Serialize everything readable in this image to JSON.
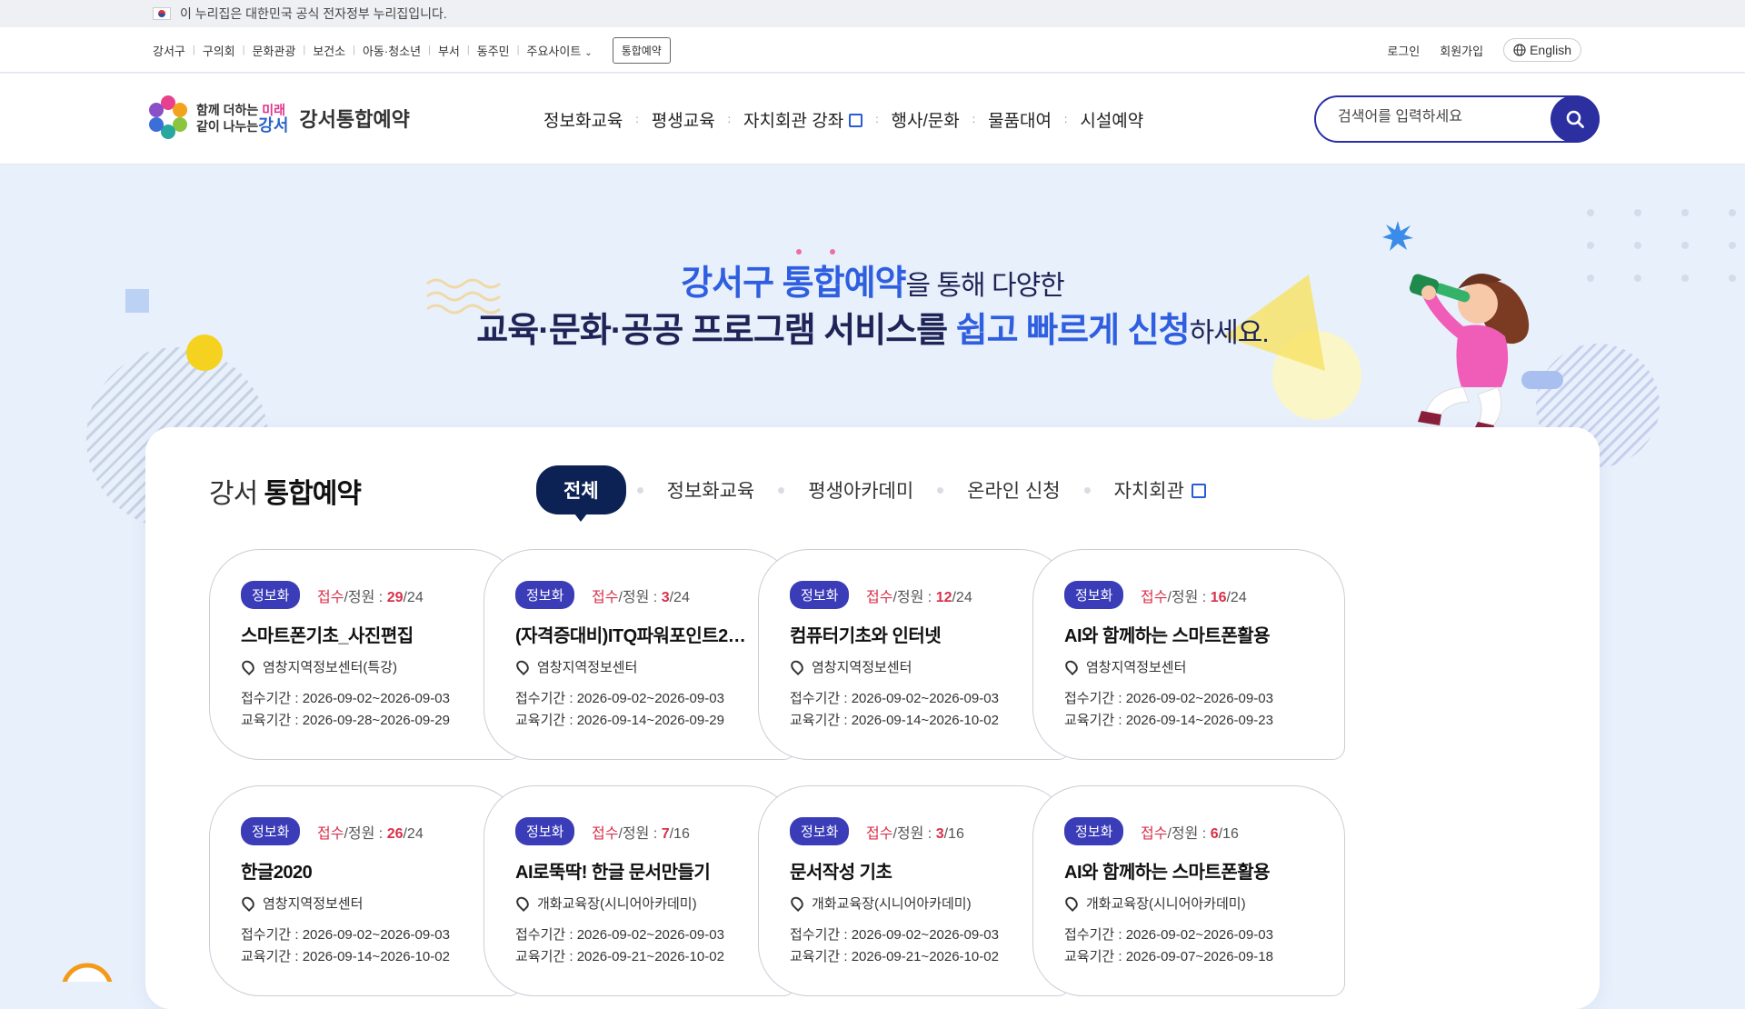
{
  "gov_banner": {
    "text": "이 누리집은 대한민국 공식 전자정부 누리집입니다."
  },
  "util": {
    "links": [
      "강서구",
      "구의회",
      "문화관광",
      "보건소",
      "아동·청소년",
      "부서",
      "동주민",
      "주요사이트"
    ],
    "reserve_button": "통합예약",
    "login": "로그인",
    "signup": "회원가입",
    "language": "English"
  },
  "header": {
    "logo_slogan_line1": "함께 더하는",
    "logo_slogan_accent1": "미래",
    "logo_slogan_line2": "같이 나누는",
    "logo_slogan_accent2": "강서",
    "logo_title": "강서통합예약",
    "nav": [
      "정보화교육",
      "평생교육",
      "자치회관 강좌",
      "행사/문화",
      "물품대여",
      "시설예약"
    ],
    "search_placeholder": "검색어를 입력하세요"
  },
  "hero": {
    "line1_blue1": "강서구",
    "line1_blue2": "통합예약",
    "line1_rest": "을 통해 다양한",
    "line2_dark": "교육·문화·공공 프로그램 서비스를",
    "line2_blue": "쉽고 빠르게 신청",
    "line2_rest": "하세요."
  },
  "panel": {
    "title_light": "강서",
    "title_bold": "통합예약",
    "tabs": [
      "전체",
      "정보화교육",
      "평생아카데미",
      "온라인 신청",
      "자치회관"
    ],
    "quota_prefix_red": "접수",
    "quota_prefix_rest": "/정원 : ",
    "period_receive_label": "접수기간 : ",
    "period_edu_label": "교육기간 : ",
    "cards": [
      {
        "badge": "정보화",
        "applied": "29",
        "capacity": "/24",
        "title": "스마트폰기초_사진편집",
        "place": "염창지역정보센터(특강)",
        "receive": "2026-09-02~2026-09-03",
        "edu": "2026-09-28~2026-09-29"
      },
      {
        "badge": "정보화",
        "applied": "3",
        "capacity": "/24",
        "title": "(자격증대비)ITQ파워포인트2…",
        "place": "염창지역정보센터",
        "receive": "2026-09-02~2026-09-03",
        "edu": "2026-09-14~2026-09-29"
      },
      {
        "badge": "정보화",
        "applied": "12",
        "capacity": "/24",
        "title": "컴퓨터기초와 인터넷",
        "place": "염창지역정보센터",
        "receive": "2026-09-02~2026-09-03",
        "edu": "2026-09-14~2026-10-02"
      },
      {
        "badge": "정보화",
        "applied": "16",
        "capacity": "/24",
        "title": "AI와 함께하는 스마트폰활용",
        "place": "염창지역정보센터",
        "receive": "2026-09-02~2026-09-03",
        "edu": "2026-09-14~2026-09-23"
      },
      {
        "badge": "정보화",
        "applied": "26",
        "capacity": "/24",
        "title": "한글2020",
        "place": "염창지역정보센터",
        "receive": "2026-09-02~2026-09-03",
        "edu": "2026-09-14~2026-10-02"
      },
      {
        "badge": "정보화",
        "applied": "7",
        "capacity": "/16",
        "title": "AI로뚝딱! 한글 문서만들기",
        "place": "개화교육장(시니어아카데미)",
        "receive": "2026-09-02~2026-09-03",
        "edu": "2026-09-21~2026-10-02"
      },
      {
        "badge": "정보화",
        "applied": "3",
        "capacity": "/16",
        "title": "문서작성 기초",
        "place": "개화교육장(시니어아카데미)",
        "receive": "2026-09-02~2026-09-03",
        "edu": "2026-09-21~2026-10-02"
      },
      {
        "badge": "정보화",
        "applied": "6",
        "capacity": "/16",
        "title": "AI와 함께하는 스마트폰활용",
        "place": "개화교육장(시니어아카데미)",
        "receive": "2026-09-02~2026-09-03",
        "edu": "2026-09-07~2026-09-18"
      }
    ]
  },
  "colors": {
    "brand_navy": "#0d2254",
    "accent_blue": "#2f5fe0",
    "badge": "#3a3cb8",
    "quota_red": "#d9304a"
  }
}
